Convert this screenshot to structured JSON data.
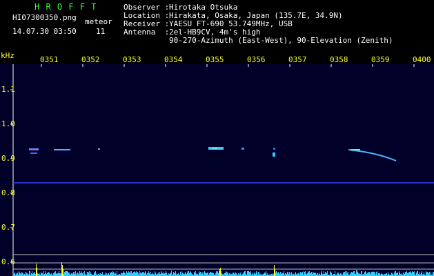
{
  "header": {
    "logo": "H R O F F T",
    "filename": "HI07300350.png",
    "datetime": "14.07.30 03:50",
    "meteor_label": "meteor",
    "meteor_count": "11",
    "observer_label": "Observer :",
    "observer_value": "Hirotaka Otsuka",
    "location_label": "Location :",
    "location_value": "Hirakata, Osaka, Japan (135.7E, 34.9N)",
    "receiver_label": "Receiver :",
    "receiver_value": "YAESU FT-690 53.749MHz, USB",
    "antenna_label": "Antenna  :",
    "antenna_value_1": "2el-HB9CV, 4m's high",
    "antenna_value_2": "90-270-Azimuth (East-West), 90-Elevation (Zenith)"
  },
  "axis": {
    "y_unit": "kHz",
    "y_ticks": [
      "1.1",
      "1.0",
      "0.9",
      "0.8",
      "0.7",
      "0.6"
    ],
    "x_ticks": [
      "0351",
      "0352",
      "0353",
      "0354",
      "0355",
      "0356",
      "0357",
      "0358",
      "0359",
      "0400"
    ]
  },
  "colors": {
    "background": "#000000",
    "plot_bg": "#000028",
    "label_text": "#ffffff",
    "tick_text": "#ffff33",
    "logo_text": "#33ff33",
    "carrier_line": "#3344ff",
    "activity": "#33ccff",
    "activity_peak": "#ffff33"
  }
}
